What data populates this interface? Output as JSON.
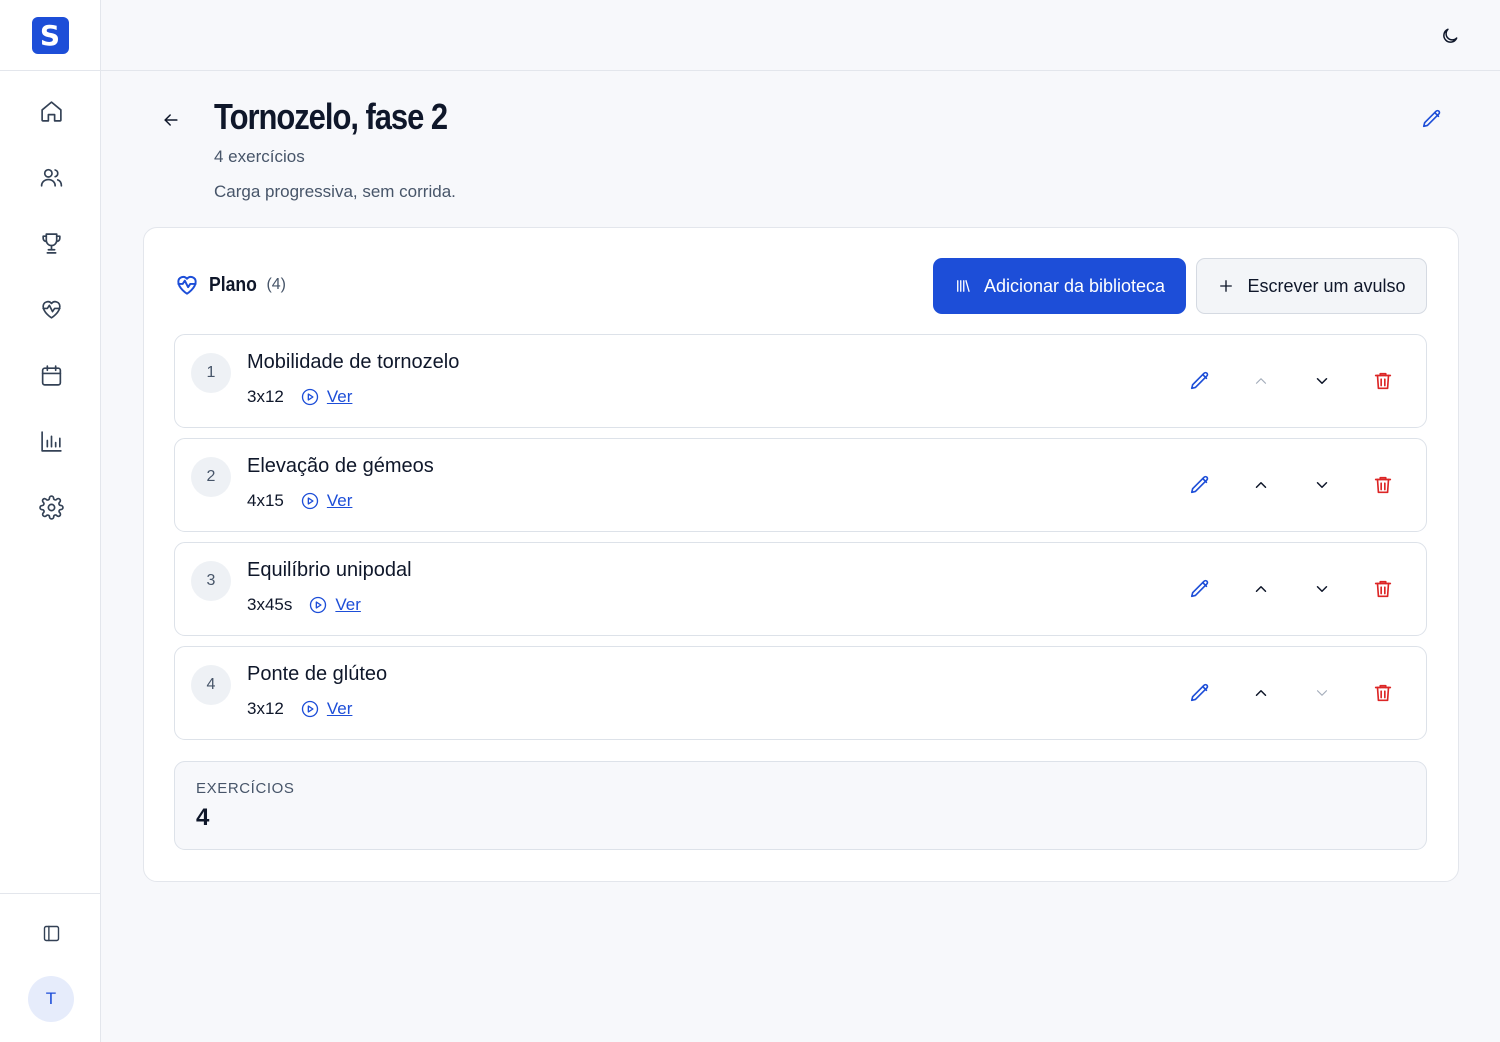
{
  "app": {
    "logo_letter": "S",
    "user_initial": "T",
    "accent_color": "#1d4ed8",
    "danger_color": "#dc2626"
  },
  "sidebar": {
    "items": [
      {
        "name": "home",
        "icon": "home-icon"
      },
      {
        "name": "users",
        "icon": "users-icon"
      },
      {
        "name": "trophy",
        "icon": "trophy-icon"
      },
      {
        "name": "health",
        "icon": "heart-pulse-icon"
      },
      {
        "name": "calendar",
        "icon": "calendar-icon"
      },
      {
        "name": "stats",
        "icon": "bar-chart-icon"
      },
      {
        "name": "settings",
        "icon": "gear-icon"
      }
    ],
    "collapse_icon": "sidebar-toggle-icon"
  },
  "topbar": {
    "theme_icon": "moon-icon"
  },
  "header": {
    "title": "Tornozelo, fase 2",
    "subtitle": "4 exercícios",
    "description": "Carga progressiva, sem corrida."
  },
  "plan": {
    "title": "Plano",
    "count": "(4)",
    "add_library_label": "Adicionar da biblioteca",
    "write_single_label": "Escrever um avulso",
    "exercises": [
      {
        "number": "1",
        "name": "Mobilidade de tornozelo",
        "sets": "3x12",
        "view_label": "Ver",
        "can_move_up": false,
        "can_move_down": true
      },
      {
        "number": "2",
        "name": "Elevação de gémeos",
        "sets": "4x15",
        "view_label": "Ver",
        "can_move_up": true,
        "can_move_down": true
      },
      {
        "number": "3",
        "name": "Equilíbrio unipodal",
        "sets": "3x45s",
        "view_label": "Ver",
        "can_move_up": true,
        "can_move_down": true
      },
      {
        "number": "4",
        "name": "Ponte de glúteo",
        "sets": "3x12",
        "view_label": "Ver",
        "can_move_up": true,
        "can_move_down": false
      }
    ],
    "summary_label": "EXERCÍCIOS",
    "summary_value": "4"
  }
}
